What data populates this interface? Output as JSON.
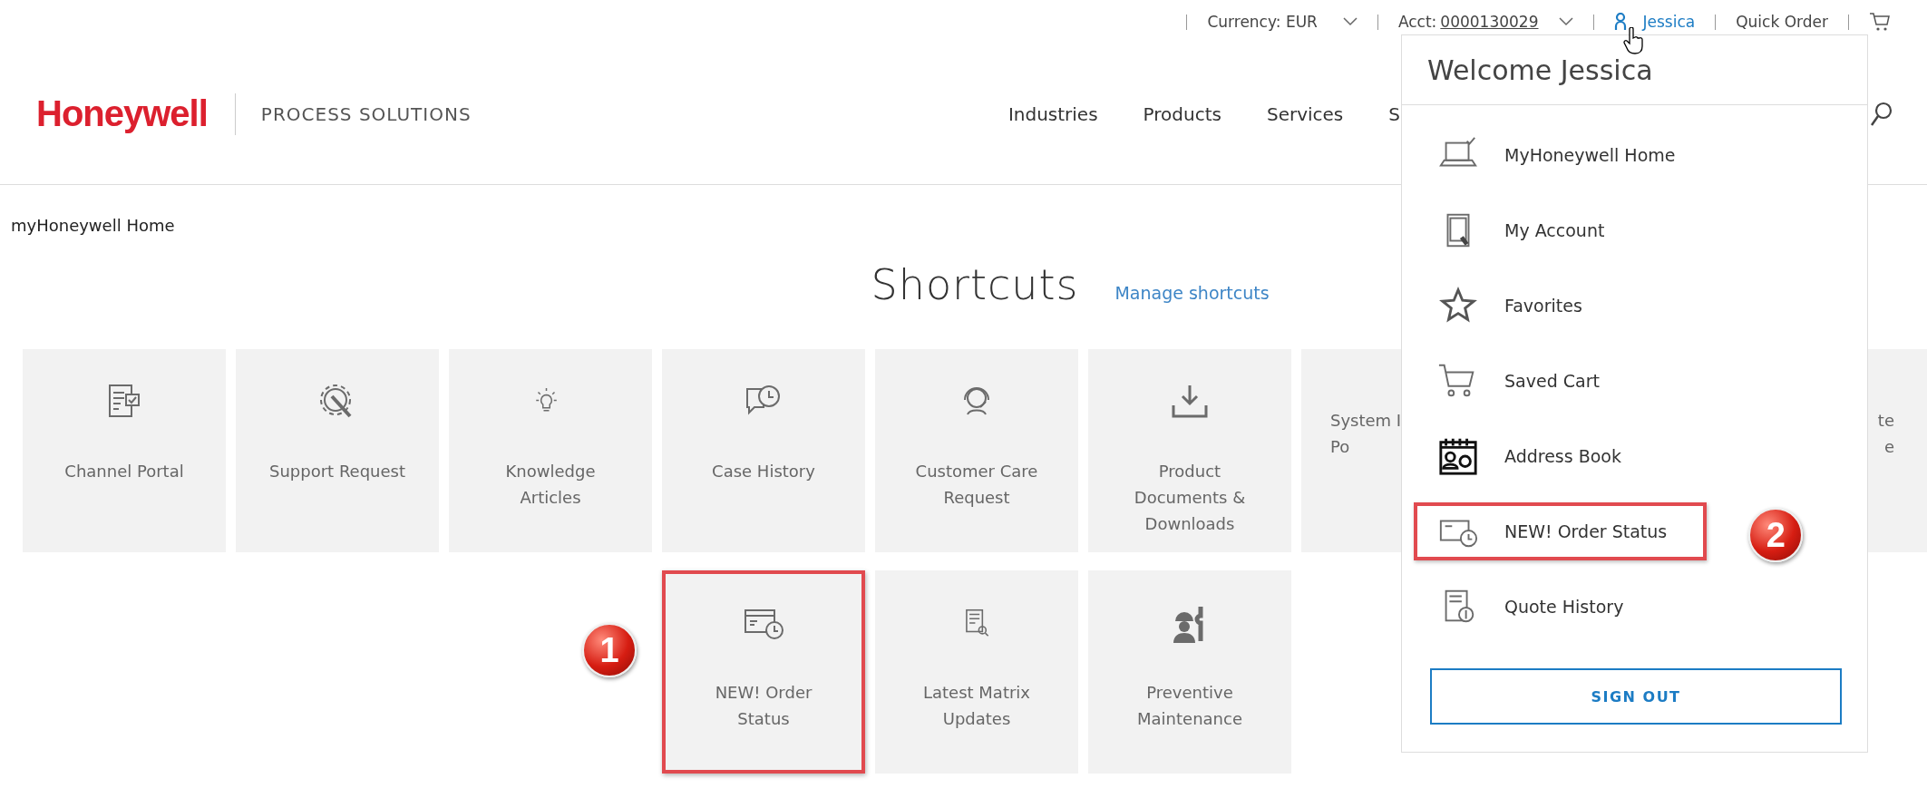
{
  "top_bar": {
    "currency": "Currency: EUR",
    "account_label": "Acct:",
    "account_number": "0000130029",
    "user": "Jessica",
    "quick_order": "Quick Order"
  },
  "header": {
    "logo": "Honeywell",
    "division": "PROCESS SOLUTIONS",
    "nav": [
      "Industries",
      "Products",
      "Services",
      "S"
    ]
  },
  "breadcrumb": "myHoneywell Home",
  "shortcuts": {
    "title": "Shortcuts",
    "manage_link": "Manage shortcuts",
    "row_1": [
      {
        "kind": "full",
        "lines": [
          "Channel Portal"
        ]
      },
      {
        "kind": "full",
        "lines": [
          "Support Request"
        ]
      },
      {
        "kind": "full",
        "lines": [
          "Knowledge",
          "Articles"
        ]
      },
      {
        "kind": "full",
        "lines": [
          "Case History"
        ]
      },
      {
        "kind": "full",
        "lines": [
          "Customer Care",
          "Request"
        ]
      },
      {
        "kind": "full",
        "lines": [
          "Product",
          "Documents &",
          "Downloads"
        ]
      },
      {
        "kind": "cut-right",
        "lines": [
          "System I",
          "Po"
        ]
      },
      {
        "kind": "cut-left",
        "lines": [
          "te",
          "e"
        ]
      }
    ],
    "row_2": [
      {
        "kind": "full",
        "lines": [
          "NEW! Order",
          "Status"
        ],
        "highlighted": true,
        "callout": "1"
      },
      {
        "kind": "full",
        "lines": [
          "Latest Matrix",
          "Updates"
        ],
        "highlighted": false
      },
      {
        "kind": "full",
        "lines": [
          "Preventive",
          "Maintenance"
        ],
        "highlighted": false
      }
    ]
  },
  "user_menu": {
    "title": "Welcome Jessica",
    "items": [
      {
        "label": "MyHoneywell Home",
        "highlighted": false
      },
      {
        "label": "My Account",
        "highlighted": false
      },
      {
        "label": "Favorites",
        "highlighted": false
      },
      {
        "label": "Saved Cart",
        "highlighted": false
      },
      {
        "label": "Address Book",
        "highlighted": false
      },
      {
        "label": "NEW! Order Status",
        "highlighted": true,
        "callout": "2"
      },
      {
        "label": "Quote History",
        "highlighted": false
      }
    ],
    "sign_out": "SIGN OUT"
  }
}
